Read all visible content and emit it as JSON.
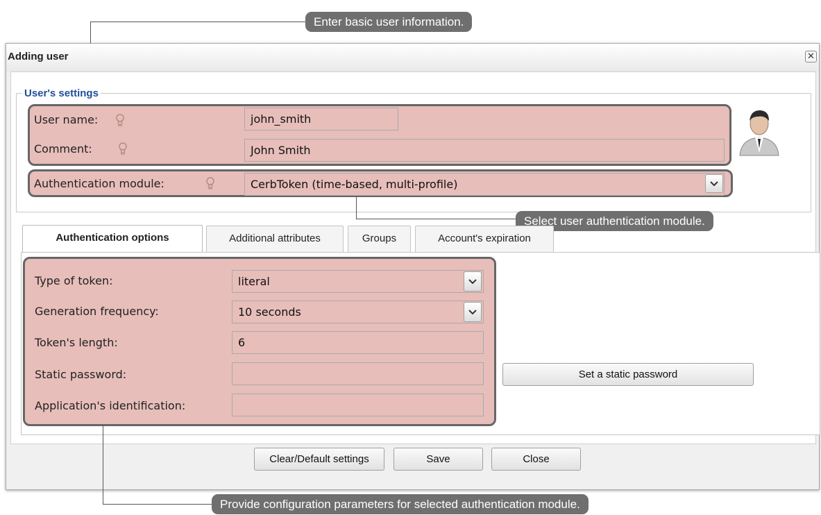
{
  "callouts": {
    "top": "Enter basic user information.",
    "auth_module": "Select user authentication module.",
    "bottom": "Provide configuration parameters for selected authentication module."
  },
  "dialog": {
    "title": "Adding user",
    "close_glyph": "✕"
  },
  "users_settings": {
    "legend": "User's settings",
    "user_name": {
      "label": "User name:",
      "value": "john_smith"
    },
    "comment": {
      "label": "Comment:",
      "value": "John Smith"
    },
    "auth_module": {
      "label": "Authentication module:",
      "value": "CerbToken (time-based, multi-profile)"
    }
  },
  "tabs": [
    {
      "label": "Authentication options",
      "active": true
    },
    {
      "label": "Additional attributes",
      "active": false
    },
    {
      "label": "Groups",
      "active": false
    },
    {
      "label": "Account's expiration",
      "active": false
    }
  ],
  "auth_options": {
    "type_of_token": {
      "label": "Type of token:",
      "value": "literal"
    },
    "generation_frequency": {
      "label": "Generation frequency:",
      "value": "10 seconds"
    },
    "token_length": {
      "label": "Token's length:",
      "value": "6"
    },
    "static_password": {
      "label": "Static password:",
      "value": ""
    },
    "application_id": {
      "label": "Application's identification:",
      "value": ""
    },
    "set_static_password_button": "Set a static password"
  },
  "footer": {
    "clear_button": "Clear/Default settings",
    "save_button": "Save",
    "close_button": "Close"
  },
  "colors": {
    "highlight": "#cd786e",
    "legend": "#1f4e9a",
    "callout": "#6f6f6f"
  },
  "icons": [
    "hint-bulb-icon",
    "user-avatar-icon",
    "chevron-down-icon",
    "close-icon"
  ]
}
